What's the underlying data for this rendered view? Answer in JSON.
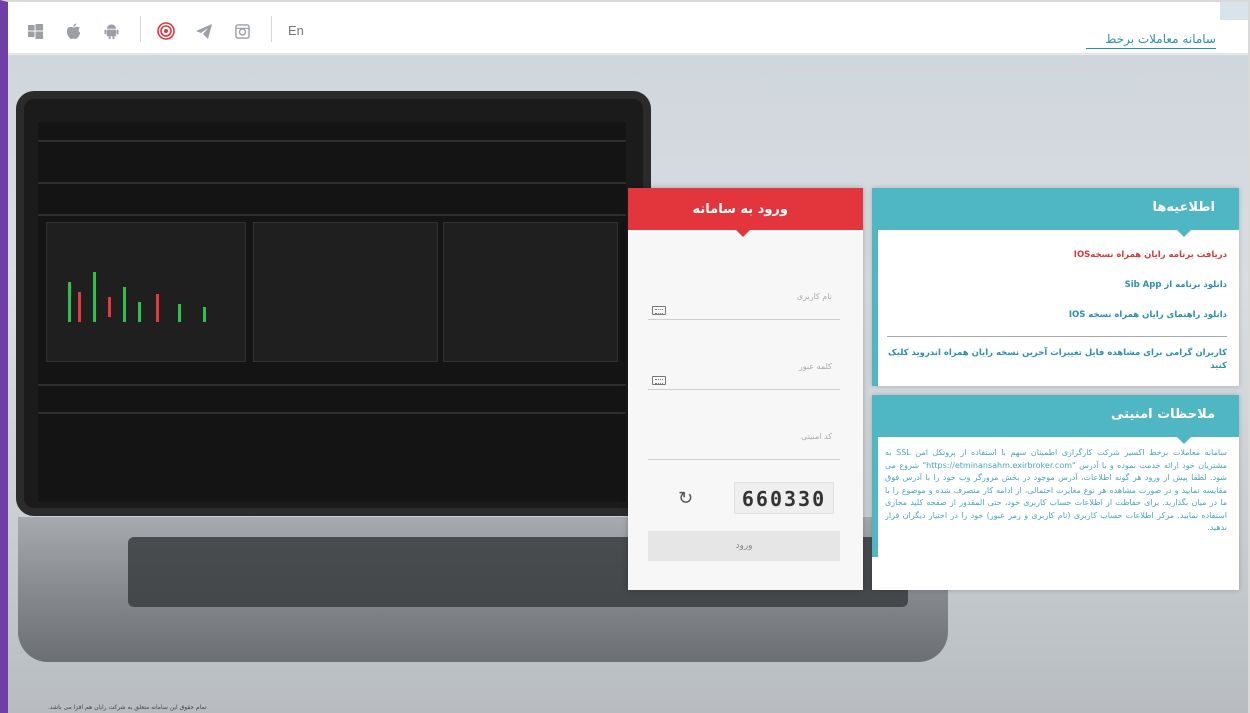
{
  "topbar": {
    "lang_label": "En",
    "brand_title": "سامانه معاملات برخط",
    "icons": [
      "windows-icon",
      "apple-icon",
      "android-icon",
      "target-icon",
      "telegram-icon",
      "instagram-icon"
    ]
  },
  "login": {
    "title": "ورود به سامانه",
    "username_placeholder": "نام کاربری",
    "password_placeholder": "کلمه عبور",
    "captcha_placeholder": "کد امنیتی",
    "captcha_value": "660330",
    "submit_label": "ورود"
  },
  "news": {
    "title": "اطلاعیه‌ها",
    "items": [
      "دریافت برنامه رایان همراه نسخهIOS",
      "دانلود برنامه از Sib App",
      "دانلود راهنمای رایان همراه نسخه IOS"
    ],
    "note": "کاربران گرامی برای مشاهده فایل تغییرات آخرین نسخه رایان همراه اندروید کلیک کنید"
  },
  "security": {
    "title": "ملاحظات امنیتی",
    "text": "سامانه معاملات برخط اکسیر شرکت کارگزاری اطمینان سهم با استفاده از پروتکل امن SSL به مشتریان خود ارائه خدمت نموده و با آدرس \"https://etminansahm.exirbroker.com\" شروع می شود. لطفا پیش از ورود هر گونه اطلاعات، آدرس موجود در بخش مرورگر وب خود را با آدرس فوق مقایسه نمایید و در صورت مشاهده هر نوع مغایرت احتمالی، از ادامه کار منصرف شده و موضوع را با ما در میان بگذارید. برای حفاظت از اطلاعات حساب کاربری خود، حتی المقدور از صفحه کلید مجازی استفاده نمایید. مرکز اطلاعات حساب کاربری (نام کاربری و رمز عبور) خود را در اختیار دیگران قرار ندهید."
  },
  "footer": {
    "copyright": "تمام حقوق این سامانه متعلق به شرکت رایان هم افزا می باشد."
  },
  "colors": {
    "login_header": "#e2363c",
    "panel_header": "#4fb7c4",
    "link": "#2c8fb0",
    "frame_accent": "#6f3fa5"
  }
}
